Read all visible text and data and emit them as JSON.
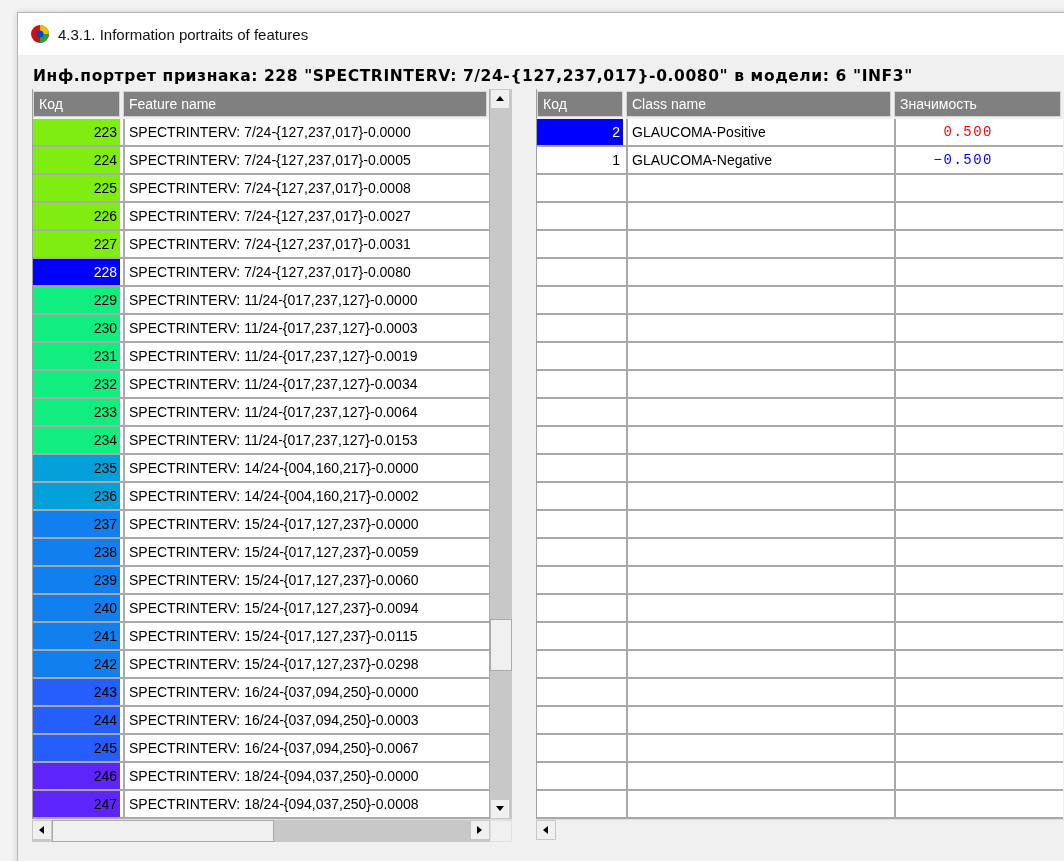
{
  "window": {
    "title": "4.3.1. Information portraits of features"
  },
  "heading": "Инф.портрет признака: 228 \"SPECTRINTERV: 7/24-{127,237,017}-0.0080\" в модели: 6 \"INF3\"",
  "features_table": {
    "columns": [
      "Код",
      "Feature name"
    ],
    "rows": [
      {
        "code": "223",
        "name": "SPECTRINTERV: 7/24-{127,237,017}-0.0000",
        "color": "#7fed11",
        "selected": false
      },
      {
        "code": "224",
        "name": "SPECTRINTERV: 7/24-{127,237,017}-0.0005",
        "color": "#7fed11",
        "selected": false
      },
      {
        "code": "225",
        "name": "SPECTRINTERV: 7/24-{127,237,017}-0.0008",
        "color": "#7fed11",
        "selected": false
      },
      {
        "code": "226",
        "name": "SPECTRINTERV: 7/24-{127,237,017}-0.0027",
        "color": "#7fed11",
        "selected": false
      },
      {
        "code": "227",
        "name": "SPECTRINTERV: 7/24-{127,237,017}-0.0031",
        "color": "#7fed11",
        "selected": false
      },
      {
        "code": "228",
        "name": "SPECTRINTERV: 7/24-{127,237,017}-0.0080",
        "selected": true
      },
      {
        "code": "229",
        "name": "SPECTRINTERV: 11/24-{017,237,127}-0.0000",
        "color": "#11ed7f",
        "selected": false
      },
      {
        "code": "230",
        "name": "SPECTRINTERV: 11/24-{017,237,127}-0.0003",
        "color": "#11ed7f",
        "selected": false
      },
      {
        "code": "231",
        "name": "SPECTRINTERV: 11/24-{017,237,127}-0.0019",
        "color": "#11ed7f",
        "selected": false
      },
      {
        "code": "232",
        "name": "SPECTRINTERV: 11/24-{017,237,127}-0.0034",
        "color": "#11ed7f",
        "selected": false
      },
      {
        "code": "233",
        "name": "SPECTRINTERV: 11/24-{017,237,127}-0.0064",
        "color": "#11ed7f",
        "selected": false
      },
      {
        "code": "234",
        "name": "SPECTRINTERV: 11/24-{017,237,127}-0.0153",
        "color": "#11ed7f",
        "selected": false
      },
      {
        "code": "235",
        "name": "SPECTRINTERV: 14/24-{004,160,217}-0.0000",
        "color": "#04a0d9",
        "selected": false
      },
      {
        "code": "236",
        "name": "SPECTRINTERV: 14/24-{004,160,217}-0.0002",
        "color": "#04a0d9",
        "selected": false
      },
      {
        "code": "237",
        "name": "SPECTRINTERV: 15/24-{017,127,237}-0.0000",
        "color": "#117fed",
        "selected": false
      },
      {
        "code": "238",
        "name": "SPECTRINTERV: 15/24-{017,127,237}-0.0059",
        "color": "#117fed",
        "selected": false
      },
      {
        "code": "239",
        "name": "SPECTRINTERV: 15/24-{017,127,237}-0.0060",
        "color": "#117fed",
        "selected": false
      },
      {
        "code": "240",
        "name": "SPECTRINTERV: 15/24-{017,127,237}-0.0094",
        "color": "#117fed",
        "selected": false
      },
      {
        "code": "241",
        "name": "SPECTRINTERV: 15/24-{017,127,237}-0.0115",
        "color": "#117fed",
        "selected": false
      },
      {
        "code": "242",
        "name": "SPECTRINTERV: 15/24-{017,127,237}-0.0298",
        "color": "#117fed",
        "selected": false
      },
      {
        "code": "243",
        "name": "SPECTRINTERV: 16/24-{037,094,250}-0.0000",
        "color": "#255efa",
        "selected": false
      },
      {
        "code": "244",
        "name": "SPECTRINTERV: 16/24-{037,094,250}-0.0003",
        "color": "#255efa",
        "selected": false
      },
      {
        "code": "245",
        "name": "SPECTRINTERV: 16/24-{037,094,250}-0.0067",
        "color": "#255efa",
        "selected": false
      },
      {
        "code": "246",
        "name": "SPECTRINTERV: 18/24-{094,037,250}-0.0000",
        "color": "#5e25fa",
        "selected": false
      },
      {
        "code": "247",
        "name": "SPECTRINTERV: 18/24-{094,037,250}-0.0008",
        "color": "#5e25fa",
        "selected": false
      }
    ]
  },
  "classes_table": {
    "columns": [
      "Код",
      "Class name",
      "Значимость"
    ],
    "rows": [
      {
        "code": "2",
        "name": "GLAUCOMA-Positive",
        "value": "0.500",
        "color": "#ff0000",
        "selected": true
      },
      {
        "code": "1",
        "name": "GLAUCOMA-Negative",
        "value": "−0.500",
        "color": "#0000ff",
        "selected": false
      }
    ]
  }
}
